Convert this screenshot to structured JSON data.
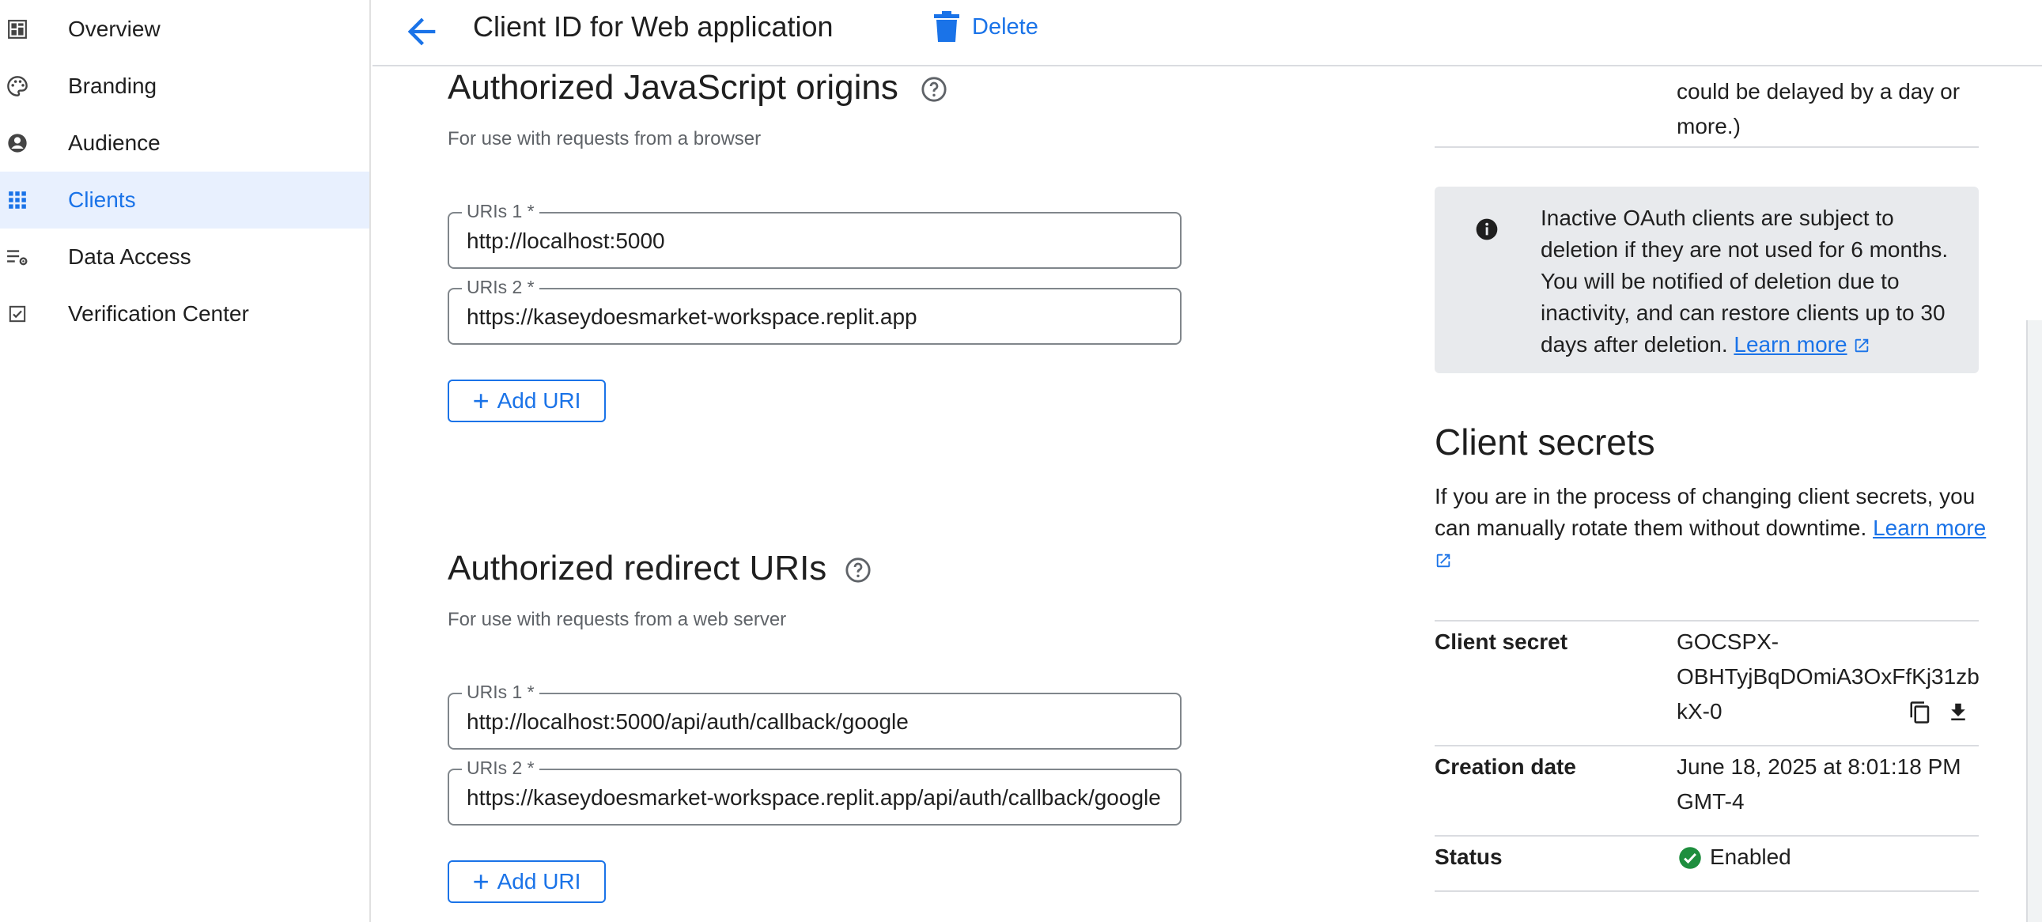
{
  "sidebar": {
    "items": [
      {
        "label": "Overview",
        "icon": "dashboard-icon"
      },
      {
        "label": "Branding",
        "icon": "palette-icon"
      },
      {
        "label": "Audience",
        "icon": "person-icon"
      },
      {
        "label": "Clients",
        "icon": "apps-grid-icon",
        "active": true
      },
      {
        "label": "Data Access",
        "icon": "data-settings-icon"
      },
      {
        "label": "Verification Center",
        "icon": "checkbox-icon"
      }
    ]
  },
  "header": {
    "title": "Client ID for Web application",
    "delete_label": "Delete"
  },
  "js_origins": {
    "title": "Authorized JavaScript origins",
    "subtitle": "For use with requests from a browser",
    "uris": [
      {
        "label": "URIs 1 *",
        "value": "http://localhost:5000"
      },
      {
        "label": "URIs 2 *",
        "value": "https://kaseydoesmarket-workspace.replit.app"
      }
    ],
    "add_label": "Add URI"
  },
  "redirect_uris": {
    "title": "Authorized redirect URIs",
    "subtitle": "For use with requests from a web server",
    "uris": [
      {
        "label": "URIs 1 *",
        "value": "http://localhost:5000/api/auth/callback/google"
      },
      {
        "label": "URIs 2 *",
        "value": "https://kaseydoesmarket-workspace.replit.app/api/auth/callback/google"
      }
    ],
    "add_label": "Add URI"
  },
  "right_panel": {
    "note_partial_top": "could be delayed by a day or",
    "note_partial_bottom": "more.)",
    "info_text": "Inactive OAuth clients are subject to deletion if they are not used for 6 months. You will be notified of deletion due to inactivity, and can restore clients up to 30 days after deletion.",
    "info_link": "Learn more",
    "secrets_title": "Client secrets",
    "secrets_desc": "If you are in the process of changing client secrets, you can manually rotate them without downtime.",
    "secrets_link": "Learn more",
    "rows": {
      "secret_key": "Client secret",
      "secret_value_line1": "GOCSPX-",
      "secret_value_line2": "OBHTyjBqDOmiA3OxFfKj31zb",
      "secret_value_line3": "kX-0",
      "creation_key": "Creation date",
      "creation_value_line1": "June 18, 2025 at 8:01:18 PM",
      "creation_value_line2": "GMT-4",
      "status_key": "Status",
      "status_value": "Enabled"
    }
  },
  "colors": {
    "accent": "#1a73e8",
    "active_bg": "#e8f0fe",
    "info_bg": "#e8eaed",
    "success": "#1e8e3e"
  }
}
